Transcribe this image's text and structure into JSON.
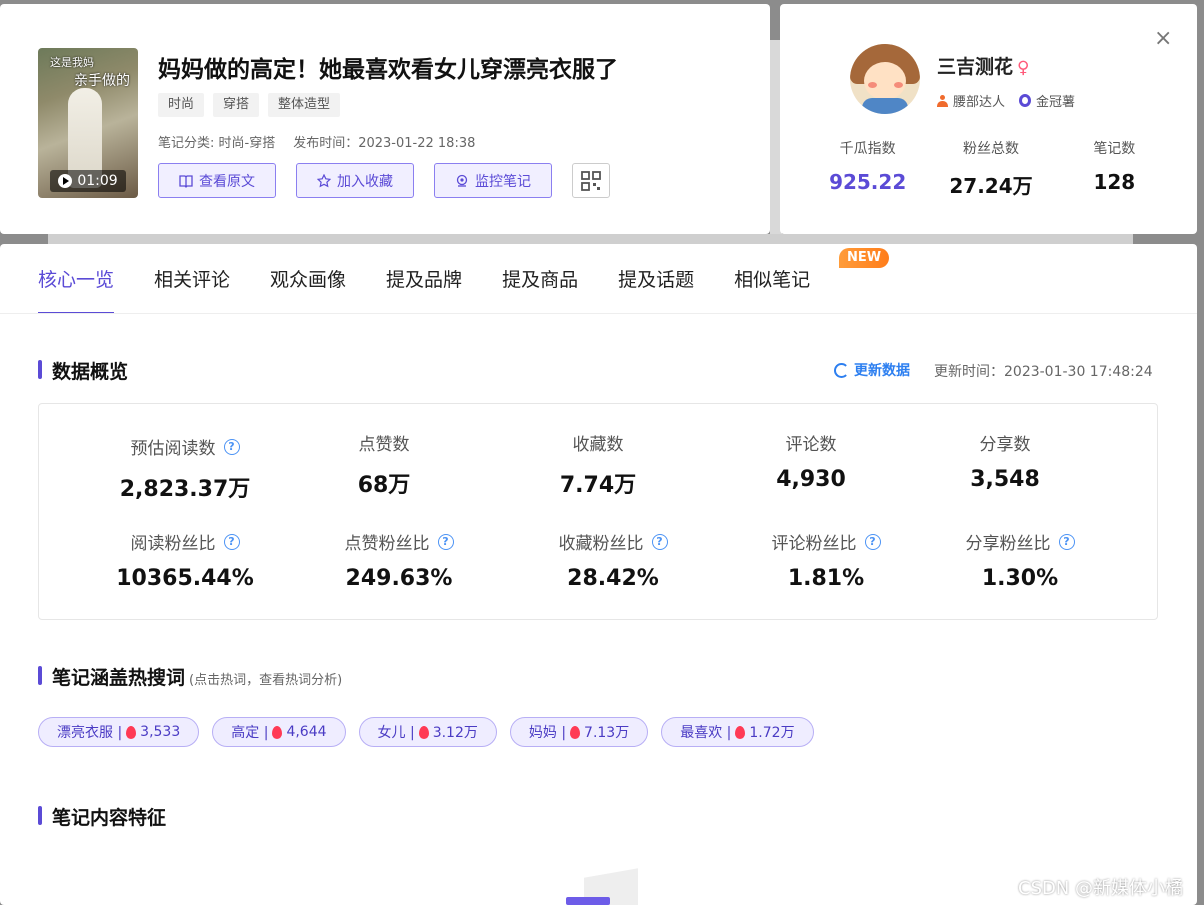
{
  "note": {
    "thumb_caption_1": "这是我妈",
    "thumb_caption_2": "亲手做的",
    "duration": "01:09",
    "title": "妈妈做的高定！她最喜欢看女儿穿漂亮衣服了",
    "tags": [
      "时尚",
      "穿搭",
      "整体造型"
    ],
    "category": "笔记分类: 时尚-穿搭",
    "publish_time": "发布时间：2023-01-22 18:38",
    "actions": [
      "查看原文",
      "加入收藏",
      "监控笔记"
    ]
  },
  "author": {
    "name": "三吉测花",
    "gender_symbol": "♀",
    "badge_1": "腰部达人",
    "badge_2": "金冠薯",
    "stats": [
      {
        "label": "千瓜指数",
        "value": "925.22"
      },
      {
        "label": "粉丝总数",
        "value": "27.24万"
      },
      {
        "label": "笔记数",
        "value": "128"
      }
    ]
  },
  "tabs": [
    "核心一览",
    "相关评论",
    "观众画像",
    "提及品牌",
    "提及商品",
    "提及话题",
    "相似笔记"
  ],
  "new_badge": "NEW",
  "overview": {
    "title": "数据概览",
    "refresh_label": "更新数据",
    "update_time": "更新时间：2023-01-30 17:48:24",
    "metrics": [
      {
        "label": "预估阅读数",
        "value": "2,823.37万"
      },
      {
        "label": "点赞数",
        "value": "68万"
      },
      {
        "label": "收藏数",
        "value": "7.74万"
      },
      {
        "label": "评论数",
        "value": "4,930"
      },
      {
        "label": "分享数",
        "value": "3,548"
      },
      {
        "label": "阅读粉丝比",
        "value": "10365.44%"
      },
      {
        "label": "点赞粉丝比",
        "value": "249.63%"
      },
      {
        "label": "收藏粉丝比",
        "value": "28.42%"
      },
      {
        "label": "评论粉丝比",
        "value": "1.81%"
      },
      {
        "label": "分享粉丝比",
        "value": "1.30%"
      }
    ]
  },
  "hot_words": {
    "title": "笔记涵盖热搜词",
    "hint": "(点击热词，查看热词分析)",
    "items": [
      {
        "word": "漂亮衣服 |",
        "count": "3,533"
      },
      {
        "word": "高定 |",
        "count": "4,644"
      },
      {
        "word": "女儿 |",
        "count": "3.12万"
      },
      {
        "word": "妈妈 |",
        "count": "7.13万"
      },
      {
        "word": "最喜欢 |",
        "count": "1.72万"
      }
    ]
  },
  "content_features": {
    "title": "笔记内容特征"
  },
  "watermark": "CSDN @新媒体小橘"
}
